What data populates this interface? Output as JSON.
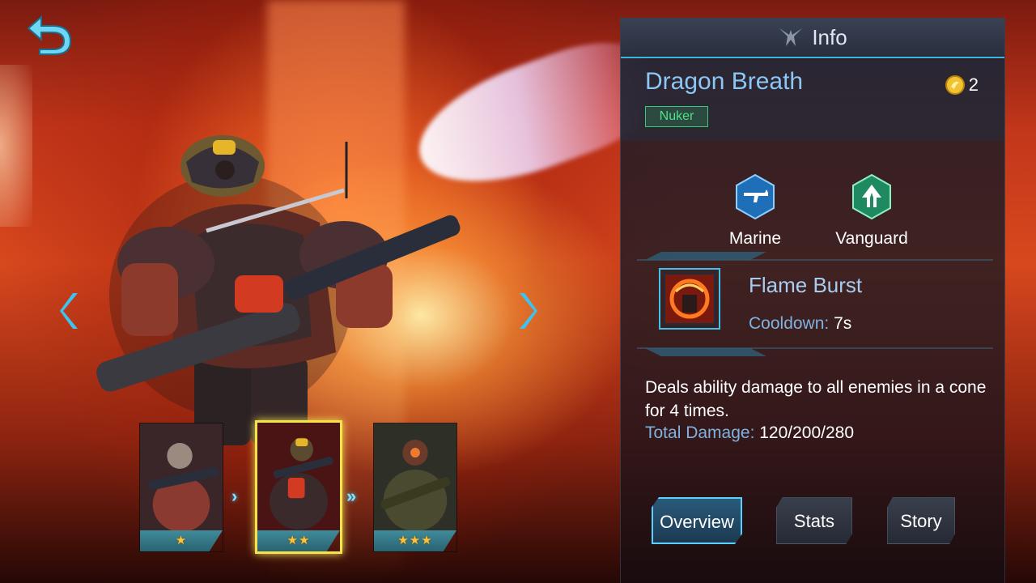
{
  "info_panel": {
    "title": "Info",
    "hero_name": "Dragon Breath",
    "role": "Nuker",
    "cost": "2",
    "classes": [
      {
        "name": "Marine",
        "icon": "rifle-hexagon-icon",
        "color": "#2a8fd6"
      },
      {
        "name": "Vanguard",
        "icon": "vanguard-hexagon-icon",
        "color": "#2aa77a"
      }
    ],
    "skill": {
      "name": "Flame Burst",
      "icon": "flame-burst-icon",
      "cooldown_label": "Cooldown:",
      "cooldown_value": "7s",
      "description": "Deals ability damage to all enemies in a cone for 4 times.",
      "total_damage_label": "Total Damage:",
      "total_damage_value": "120/200/280"
    },
    "tabs": [
      {
        "label": "Overview",
        "active": true
      },
      {
        "label": "Stats",
        "active": false
      },
      {
        "label": "Story",
        "active": false
      }
    ]
  },
  "skins": [
    {
      "stars": "★",
      "selected": false
    },
    {
      "stars": "★★",
      "selected": true
    },
    {
      "stars": "★★★",
      "selected": false
    }
  ],
  "colors": {
    "accent": "#38b6e6",
    "hero_name": "#8cc6f5",
    "role_tag": "#52e08a",
    "star": "#ffc33a",
    "selected_border": "#f4e34b"
  }
}
